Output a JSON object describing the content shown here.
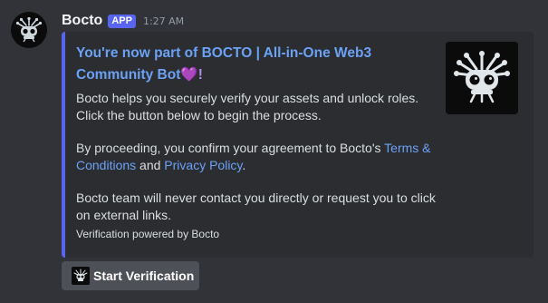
{
  "author": {
    "name": "Bocto",
    "badge": "APP",
    "timestamp": "1:27 AM",
    "avatar_icon": "bocto-robot-icon"
  },
  "embed": {
    "accent_color": "#5865f2",
    "title": "You're now part of BOCTO | All-in-One Web3 Community Bot",
    "title_emoji": "💜!",
    "thumbnail_icon": "bocto-robot-icon",
    "paragraph1": "Bocto helps you securely verify your assets and unlock roles. Click the button below to begin the process.",
    "paragraph2_prefix": "By proceeding, you confirm your agreement to Bocto's ",
    "terms_link": "Terms & Conditions",
    "paragraph2_and": " and ",
    "privacy_link": "Privacy Policy",
    "paragraph2_suffix": ".",
    "paragraph3": "Bocto team will never contact you directly or request you to click on external links.",
    "footer": "Verification powered by Bocto"
  },
  "button": {
    "label": "Start Verification",
    "icon": "bocto-robot-icon"
  }
}
